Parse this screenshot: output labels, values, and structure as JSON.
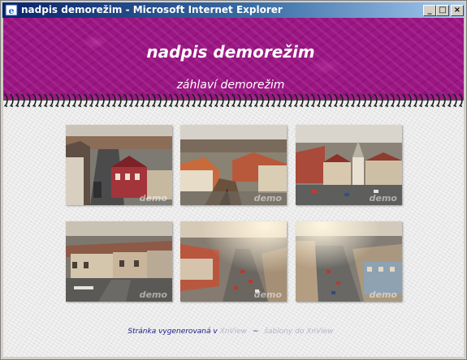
{
  "window": {
    "title": "nadpis demorežim - Microsoft Internet Explorer",
    "minimize": "_",
    "maximize": "□",
    "close": "×"
  },
  "header": {
    "title": "nadpis demorežim",
    "subtitle": "záhlaví demorežim",
    "background": "#9b1583"
  },
  "gallery": {
    "watermark": "demo",
    "thumbnails": [
      {
        "name": "photo-thumbnail-1"
      },
      {
        "name": "photo-thumbnail-2"
      },
      {
        "name": "photo-thumbnail-3"
      },
      {
        "name": "photo-thumbnail-4"
      },
      {
        "name": "photo-thumbnail-5"
      },
      {
        "name": "photo-thumbnail-6"
      }
    ]
  },
  "footer": {
    "text": "Stránka vygenerovaná v",
    "link1": "XnView",
    "separator": "~",
    "link2": "šablony do XnView"
  }
}
